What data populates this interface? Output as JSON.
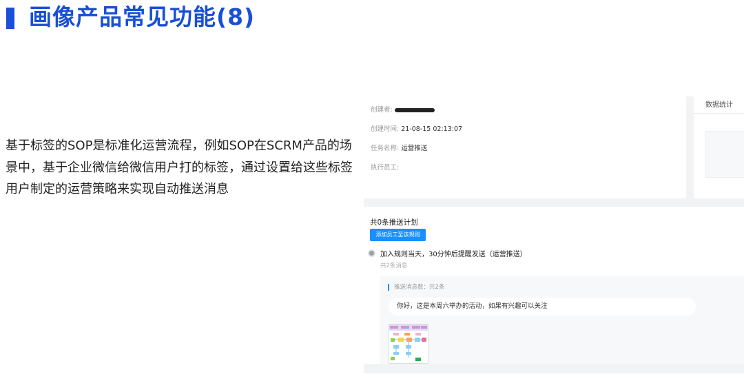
{
  "slide": {
    "title": "画像产品常见功能(8)",
    "description": "基于标签的SOP是标准化运营流程，例如SOP在SCRM产品的场景中，基于企业微信给微信用户打的标签，通过设置给这些标签用户制定的运营策略来实现自动推送消息"
  },
  "task_info": {
    "creator_label": "创建者:",
    "created_time_label": "创建时间:",
    "created_time_value": "21-08-15 02:13:07",
    "task_name_label": "任务名称:",
    "task_name_value": "运营推送",
    "executor_label": "执行员工:"
  },
  "stats": {
    "title": "数据统计"
  },
  "plan": {
    "count_text": "共0条推送计划",
    "add_button": "添加员工至该规则",
    "rule_title": "加入规则当天，30分钟后提醒发送（运营推送）",
    "rule_sub": "共2条消息",
    "message_count": "推送消息数：共2条",
    "message_text": "你好，这是本周六举办的活动，如果有兴趣可以关注"
  },
  "colors": {
    "accent": "#1a4fd6",
    "button": "#1890ff"
  }
}
